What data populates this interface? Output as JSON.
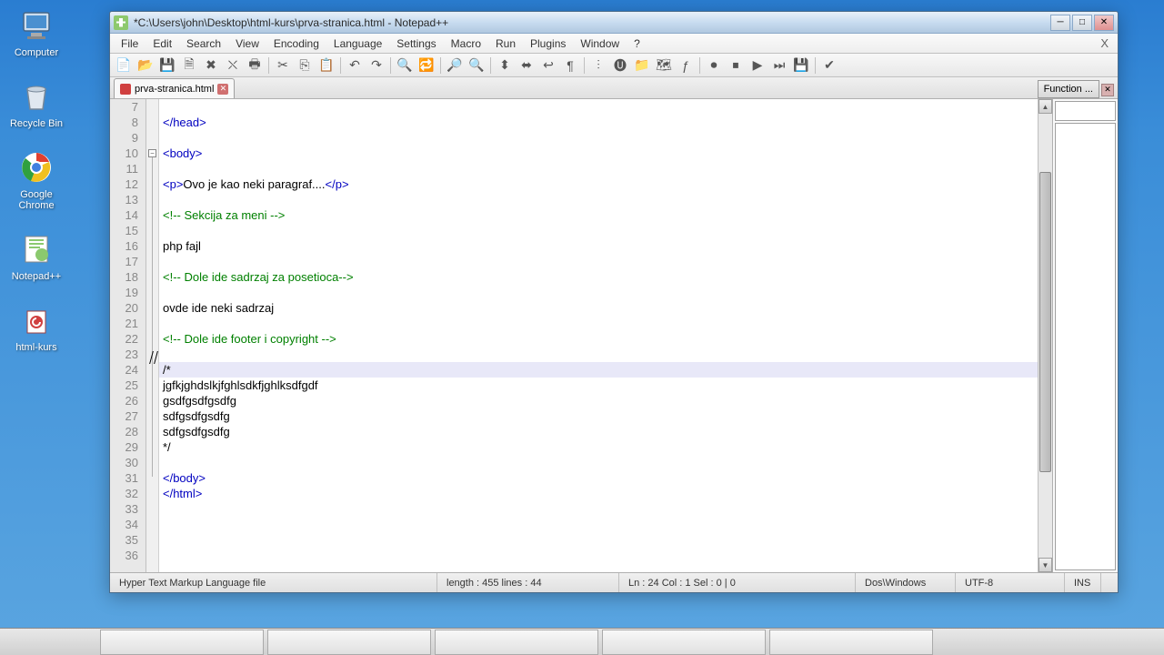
{
  "desktop": {
    "icons": [
      {
        "name": "computer-icon",
        "label": "Computer"
      },
      {
        "name": "recycle-bin-icon",
        "label": "Recycle Bin"
      },
      {
        "name": "chrome-icon",
        "label": "Google Chrome"
      },
      {
        "name": "notepadpp-icon",
        "label": "Notepad++"
      },
      {
        "name": "folder-icon",
        "label": "html-kurs"
      }
    ]
  },
  "window": {
    "title": "*C:\\Users\\john\\Desktop\\html-kurs\\prva-stranica.html - Notepad++"
  },
  "menubar": [
    "File",
    "Edit",
    "Search",
    "View",
    "Encoding",
    "Language",
    "Settings",
    "Macro",
    "Run",
    "Plugins",
    "Window",
    "?"
  ],
  "menubar_close": "X",
  "tab": {
    "label": "prva-stranica.html"
  },
  "function_panel": {
    "button": "Function ..."
  },
  "editor": {
    "first_line": 7,
    "current_line": 24,
    "lines": [
      {
        "n": 7,
        "segs": []
      },
      {
        "n": 8,
        "segs": [
          {
            "c": "tag",
            "t": "</head>"
          }
        ]
      },
      {
        "n": 9,
        "segs": []
      },
      {
        "n": 10,
        "segs": [
          {
            "c": "tag",
            "t": "<body>"
          }
        ],
        "fold": "-"
      },
      {
        "n": 11,
        "segs": []
      },
      {
        "n": 12,
        "segs": [
          {
            "c": "tag",
            "t": "<p>"
          },
          {
            "c": "txt",
            "t": "Ovo je kao neki paragraf...."
          },
          {
            "c": "tag",
            "t": "</p>"
          }
        ]
      },
      {
        "n": 13,
        "segs": []
      },
      {
        "n": 14,
        "segs": [
          {
            "c": "cmt",
            "t": "<!-- Sekcija za meni -->"
          }
        ]
      },
      {
        "n": 15,
        "segs": []
      },
      {
        "n": 16,
        "segs": [
          {
            "c": "txt",
            "t": "php fajl"
          }
        ]
      },
      {
        "n": 17,
        "segs": []
      },
      {
        "n": 18,
        "segs": [
          {
            "c": "cmt",
            "t": "<!-- Dole ide sadrzaj za posetioca-->"
          }
        ]
      },
      {
        "n": 19,
        "segs": []
      },
      {
        "n": 20,
        "segs": [
          {
            "c": "txt",
            "t": "ovde ide neki sadrzaj"
          }
        ]
      },
      {
        "n": 21,
        "segs": []
      },
      {
        "n": 22,
        "segs": [
          {
            "c": "cmt",
            "t": "<!-- Dole ide footer i copyright -->"
          }
        ]
      },
      {
        "n": 23,
        "segs": []
      },
      {
        "n": 24,
        "segs": [
          {
            "c": "txt",
            "t": "/*"
          }
        ]
      },
      {
        "n": 25,
        "segs": [
          {
            "c": "txt",
            "t": "jgfkjghdslkjfghlsdkfjghlksdfgdf"
          }
        ]
      },
      {
        "n": 26,
        "segs": [
          {
            "c": "txt",
            "t": "gsdfgsdfgsdfg"
          }
        ]
      },
      {
        "n": 27,
        "segs": [
          {
            "c": "txt",
            "t": "sdfgsdfgsdfg"
          }
        ]
      },
      {
        "n": 28,
        "segs": [
          {
            "c": "txt",
            "t": "sdfgsdfgsdfg"
          }
        ]
      },
      {
        "n": 29,
        "segs": [
          {
            "c": "txt",
            "t": "*/"
          }
        ]
      },
      {
        "n": 30,
        "segs": []
      },
      {
        "n": 31,
        "segs": [
          {
            "c": "tag",
            "t": "</body>"
          }
        ]
      },
      {
        "n": 32,
        "segs": [
          {
            "c": "tag",
            "t": "</html>"
          }
        ]
      },
      {
        "n": 33,
        "segs": []
      },
      {
        "n": 34,
        "segs": []
      },
      {
        "n": 35,
        "segs": []
      },
      {
        "n": 36,
        "segs": []
      }
    ]
  },
  "statusbar": {
    "filetype": "Hyper Text Markup Language file",
    "length_lines": "length : 455     lines : 44",
    "pos": "Ln : 24   Col : 1   Sel : 0 | 0",
    "eol": "Dos\\Windows",
    "encoding": "UTF-8",
    "mode": "INS"
  },
  "toolbar_icons": [
    "new-file-icon",
    "open-file-icon",
    "save-icon",
    "save-all-icon",
    "close-icon",
    "close-all-icon",
    "print-icon",
    "cut-icon",
    "copy-icon",
    "paste-icon",
    "undo-icon",
    "redo-icon",
    "find-icon",
    "replace-icon",
    "zoom-in-icon",
    "zoom-out-icon",
    "sync-v-icon",
    "sync-h-icon",
    "wrap-icon",
    "show-all-icon",
    "indent-guide-icon",
    "user-lang-icon",
    "folder-icon",
    "doc-map-icon",
    "func-list-icon",
    "record-icon",
    "stop-icon",
    "play-icon",
    "play-multi-icon",
    "save-macro-icon",
    "spell-icon"
  ]
}
